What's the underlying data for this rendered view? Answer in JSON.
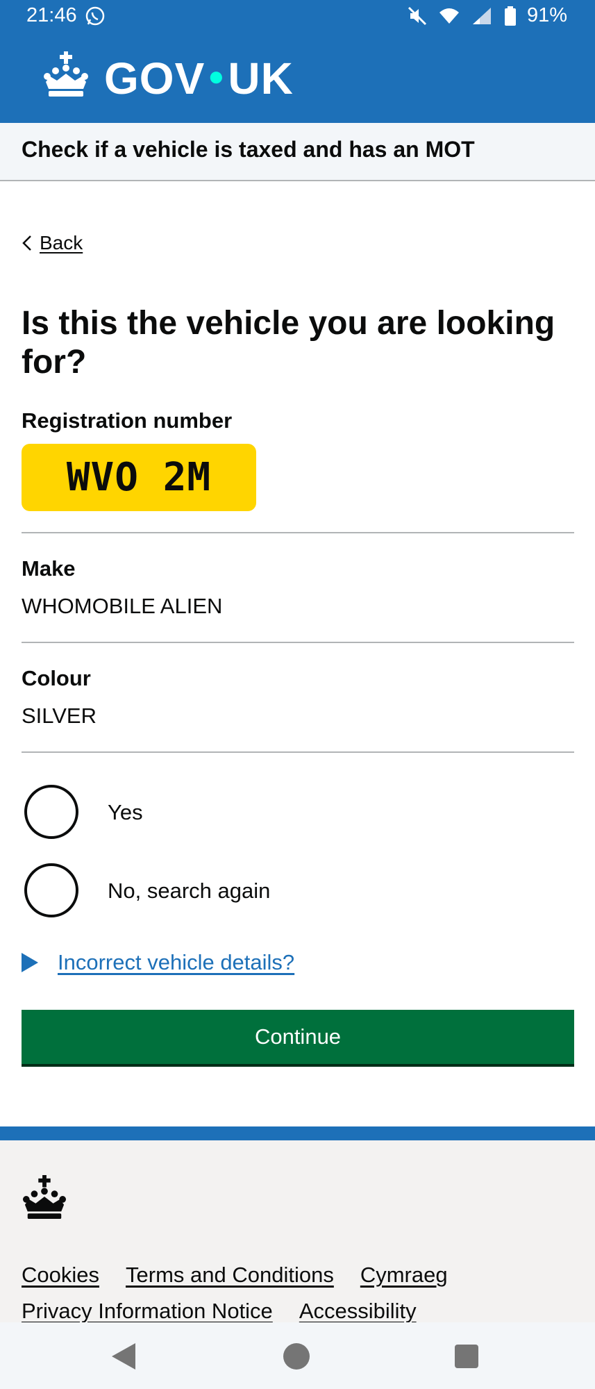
{
  "status_bar": {
    "time": "21:46",
    "battery": "91%",
    "icons": [
      "whatsapp-icon",
      "mute-icon",
      "wifi-icon",
      "signal-icon",
      "battery-icon"
    ]
  },
  "header": {
    "logo_text_left": "GOV",
    "logo_text_right": "UK",
    "logo_icon": "crown-icon"
  },
  "service_name": "Check if a vehicle is taxed and has an MOT",
  "back_link": "Back",
  "page_title": "Is this the vehicle you are looking for?",
  "registration": {
    "label": "Registration number",
    "plate": "WVO 2M"
  },
  "summary": [
    {
      "key": "Make",
      "value": "WHOMOBILE ALIEN"
    },
    {
      "key": "Colour",
      "value": "SILVER"
    }
  ],
  "radios": [
    {
      "label": "Yes",
      "checked": false
    },
    {
      "label": "No, search again",
      "checked": false
    }
  ],
  "details_summary": "Incorrect vehicle details?",
  "continue_label": "Continue",
  "footer": {
    "links_row1": [
      "Cookies",
      "Terms and Conditions",
      "Cymraeg"
    ],
    "links_row2": [
      "Privacy Information Notice",
      "Accessibility"
    ]
  },
  "colors": {
    "brand_blue": "#1d70b8",
    "plate_yellow": "#ffd500",
    "button_green": "#00703c",
    "link_blue": "#1d70b8",
    "crown_dot_turquoise": "#00ffe0"
  }
}
